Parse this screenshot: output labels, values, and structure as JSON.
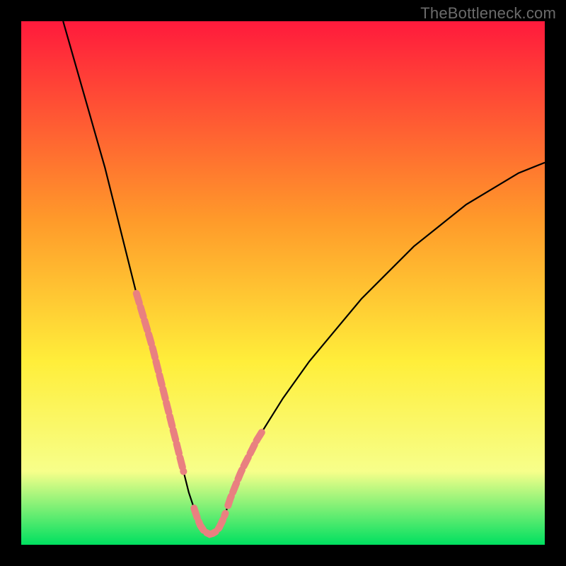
{
  "watermark": "TheBottleneck.com",
  "colors": {
    "gradient_top": "#ff1a3c",
    "gradient_mid1": "#ff9a2a",
    "gradient_mid2": "#ffee3a",
    "gradient_mid3": "#f7ff8a",
    "gradient_bottom": "#00e060",
    "curve": "#000000",
    "marker": "#e98080",
    "page_bg": "#000000"
  },
  "chart_data": {
    "type": "line",
    "title": "",
    "xlabel": "",
    "ylabel": "",
    "xlim": [
      0,
      100
    ],
    "ylim": [
      0,
      100
    ],
    "series": [
      {
        "name": "main-curve",
        "x": [
          8,
          10,
          12,
          14,
          16,
          18,
          20,
          22,
          25,
          27,
          29,
          30,
          31,
          32,
          33,
          34,
          35,
          36,
          37,
          38,
          39,
          40,
          42,
          45,
          50,
          55,
          60,
          65,
          70,
          75,
          80,
          85,
          90,
          95,
          100
        ],
        "y": [
          100,
          93,
          86,
          79,
          72,
          64,
          56,
          48,
          38,
          30,
          22,
          18,
          14,
          10,
          7,
          4,
          2.5,
          2,
          2.3,
          3.5,
          6,
          9,
          14,
          20,
          28,
          35,
          41,
          47,
          52,
          57,
          61,
          65,
          68,
          71,
          73
        ]
      }
    ],
    "highlighted_segments": [
      {
        "name": "left-band",
        "x_range": [
          22,
          31
        ],
        "y_range": [
          48,
          14
        ]
      },
      {
        "name": "valley-band",
        "x_range": [
          33,
          39
        ],
        "y_range": [
          7,
          6
        ]
      },
      {
        "name": "right-band",
        "x_range": [
          39.5,
          46
        ],
        "y_range": [
          8,
          22
        ]
      }
    ],
    "annotations": []
  }
}
